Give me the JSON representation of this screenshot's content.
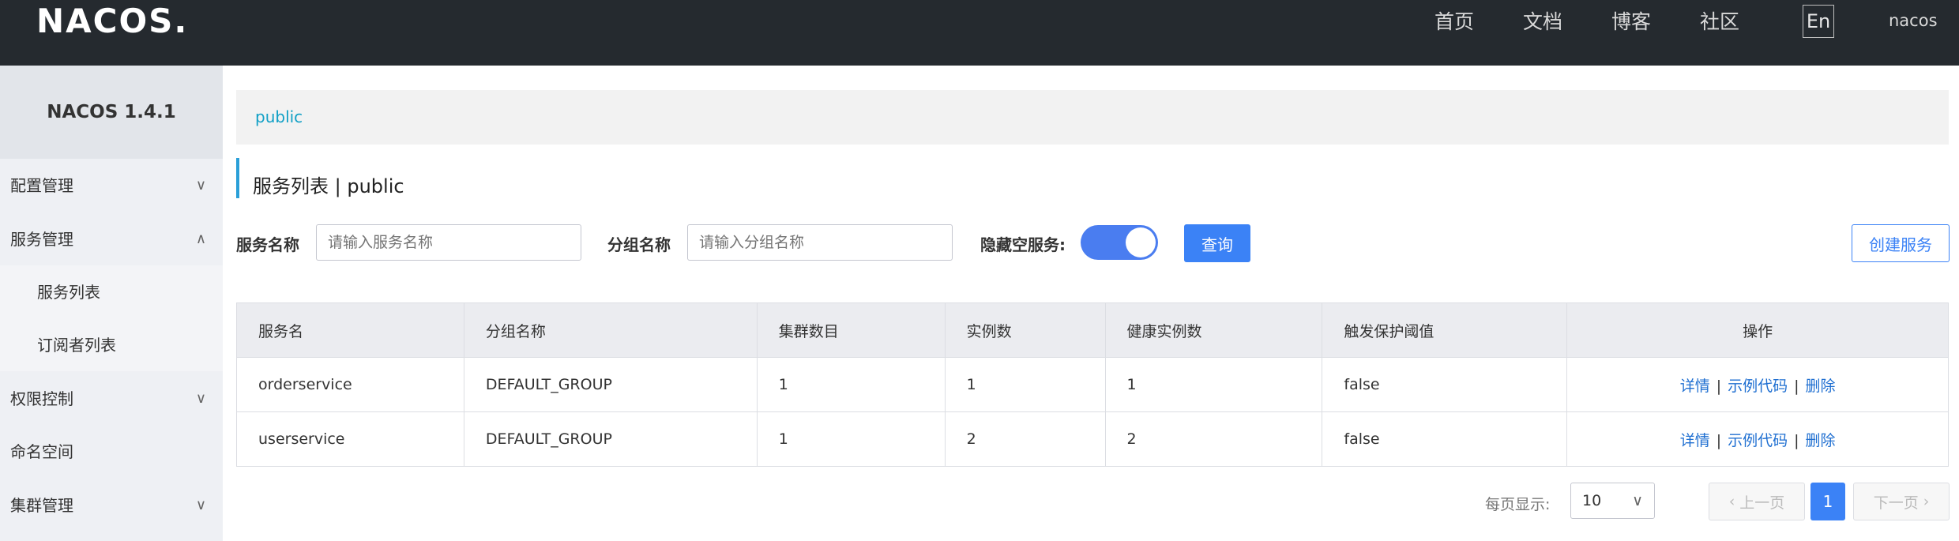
{
  "header": {
    "logo": "NACOS.",
    "nav": [
      "首页",
      "文档",
      "博客",
      "社区"
    ],
    "lang": "En",
    "user": "nacos"
  },
  "sidebar": {
    "brand": "NACOS 1.4.1",
    "items": [
      {
        "label": "配置管理",
        "chevron": "∨"
      },
      {
        "label": "服务管理",
        "chevron": "∧"
      },
      {
        "label": "权限控制",
        "chevron": "∨"
      },
      {
        "label": "命名空间"
      },
      {
        "label": "集群管理",
        "chevron": "∨"
      }
    ],
    "subitems": [
      "服务列表",
      "订阅者列表"
    ]
  },
  "breadcrumb": "public",
  "page_title": "服务列表 | public",
  "filters": {
    "service_label": "服务名称",
    "service_placeholder": "请输入服务名称",
    "group_label": "分组名称",
    "group_placeholder": "请输入分组名称",
    "hide_empty_label": "隐藏空服务:",
    "hide_empty_on": true,
    "query_button": "查询",
    "create_button": "创建服务"
  },
  "table": {
    "columns": [
      "服务名",
      "分组名称",
      "集群数目",
      "实例数",
      "健康实例数",
      "触发保护阈值",
      "操作"
    ],
    "rows": [
      [
        "orderservice",
        "DEFAULT_GROUP",
        "1",
        "1",
        "1",
        "false"
      ],
      [
        "userservice",
        "DEFAULT_GROUP",
        "1",
        "2",
        "2",
        "false"
      ]
    ],
    "actions": [
      "详情",
      "示例代码",
      "删除"
    ],
    "action_sep": "|"
  },
  "pagination": {
    "per_page_label": "每页显示:",
    "per_page_value": "10",
    "prev": "上一页",
    "current": "1",
    "next": "下一页"
  },
  "colors": {
    "header_bg": "#252a2f",
    "accent": "#3b82f6",
    "link": "#1f6fd1",
    "breadcrumb": "#12a0c6"
  }
}
